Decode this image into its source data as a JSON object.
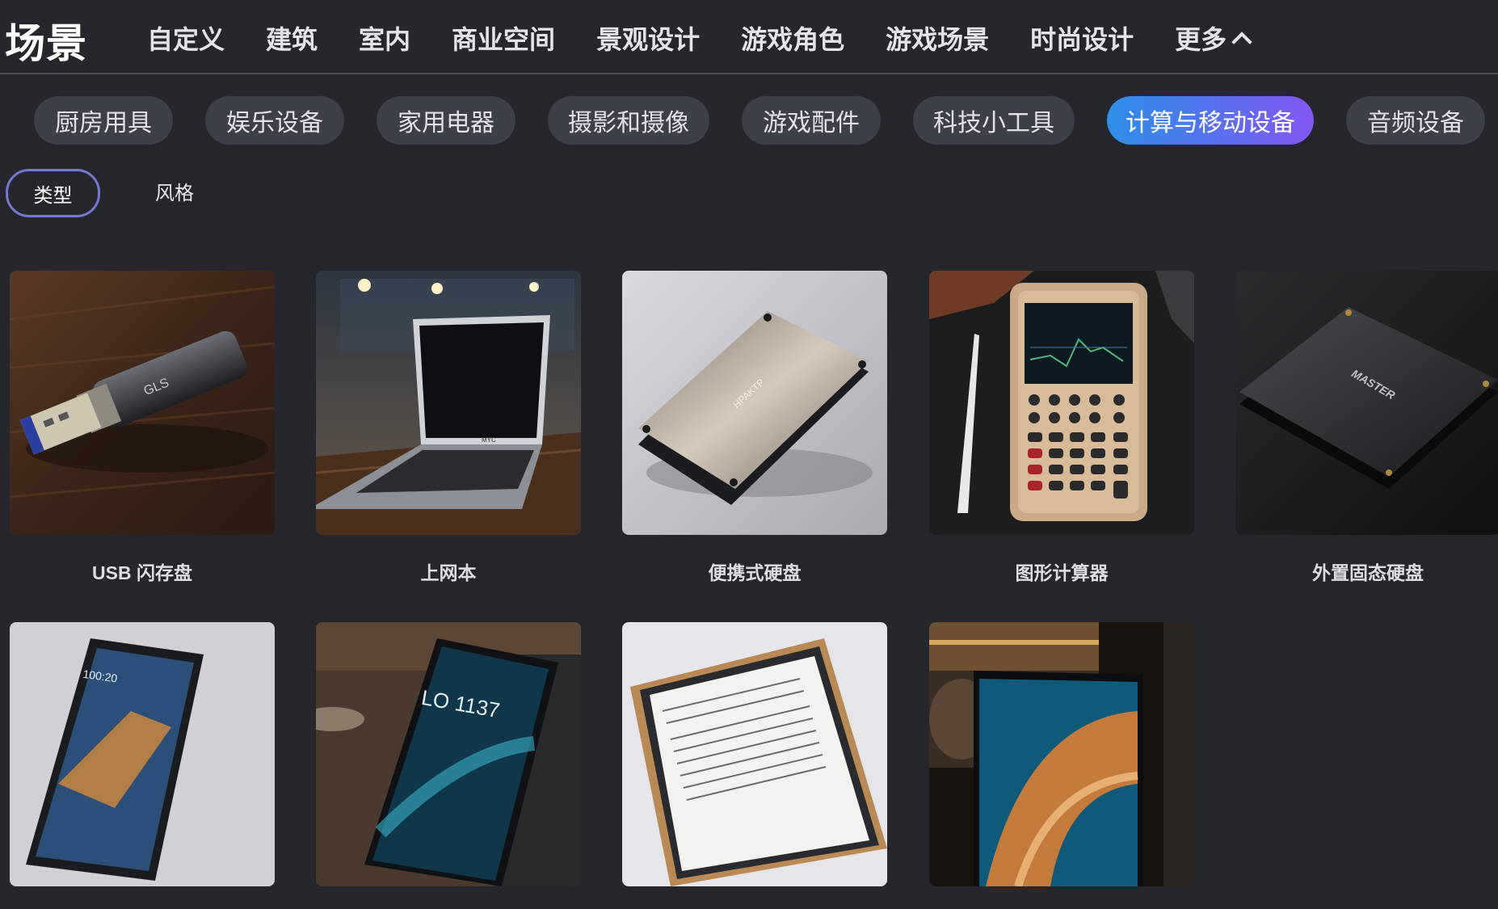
{
  "header": {
    "title": "场景",
    "nav": [
      "自定义",
      "建筑",
      "室内",
      "商业空间",
      "景观设计",
      "游戏角色",
      "游戏场景",
      "时尚设计"
    ],
    "more_label": "更多"
  },
  "categories": {
    "items": [
      "厨房用具",
      "娱乐设备",
      "家用电器",
      "摄影和摄像",
      "游戏配件",
      "科技小工具",
      "计算与移动设备",
      "音频设备"
    ],
    "active": "计算与移动设备"
  },
  "subtabs": {
    "type_label": "类型",
    "style_label": "风格"
  },
  "gallery": {
    "items": [
      {
        "label": "USB 闪存盘",
        "image": "usb-flash-drive"
      },
      {
        "label": "上网本",
        "image": "netbook"
      },
      {
        "label": "便携式硬盘",
        "image": "portable-hard-drive"
      },
      {
        "label": "图形计算器",
        "image": "graphing-calculator"
      },
      {
        "label": "外置固态硬盘",
        "image": "external-ssd"
      },
      {
        "label": "",
        "image": "tablet"
      },
      {
        "label": "",
        "image": "smartphone"
      },
      {
        "label": "",
        "image": "e-reader"
      },
      {
        "label": "",
        "image": "laptop"
      }
    ],
    "image_text": {
      "usb_brand": "GLS",
      "netbook_brand": "MYC",
      "hdd_brand": "HPAKTP",
      "ssd_brand": "MASTER",
      "phone_time": "LO 1137",
      "tablet_time": "100:20"
    }
  },
  "colors": {
    "background": "#25272c",
    "chip": "#3d4049",
    "active_gradient_start": "#2d8fe6",
    "active_gradient_end": "#8457f4",
    "subtab_border": "#7479d0"
  }
}
